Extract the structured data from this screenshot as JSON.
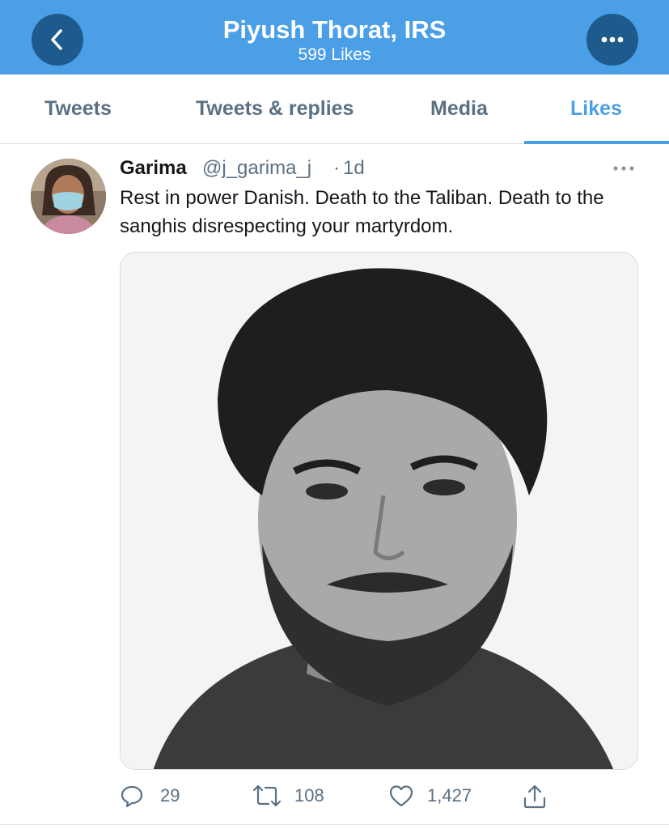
{
  "header": {
    "title": "Piyush Thorat, IRS",
    "subtitle": "599 Likes",
    "back_icon": "chevron-left-icon",
    "more_icon": "more-horizontal-icon",
    "bar_color": "#4a9fe6"
  },
  "tabs": [
    {
      "label": "Tweets",
      "active": false
    },
    {
      "label": "Tweets & replies",
      "active": false
    },
    {
      "label": "Media",
      "active": false
    },
    {
      "label": "Likes",
      "active": true
    }
  ],
  "tweet": {
    "author_name": "Garima",
    "author_handle": "@j_garima_j",
    "separator": "·",
    "time": "1d",
    "text": "Rest in power Danish. Death to the Taliban. Death to the sanghis disrespecting your martyrdom.",
    "actions": {
      "replies": "29",
      "retweets": "108",
      "likes": "1,427"
    }
  },
  "colors": {
    "accent": "#4a9fe6",
    "secondary_text": "#5b7083"
  }
}
